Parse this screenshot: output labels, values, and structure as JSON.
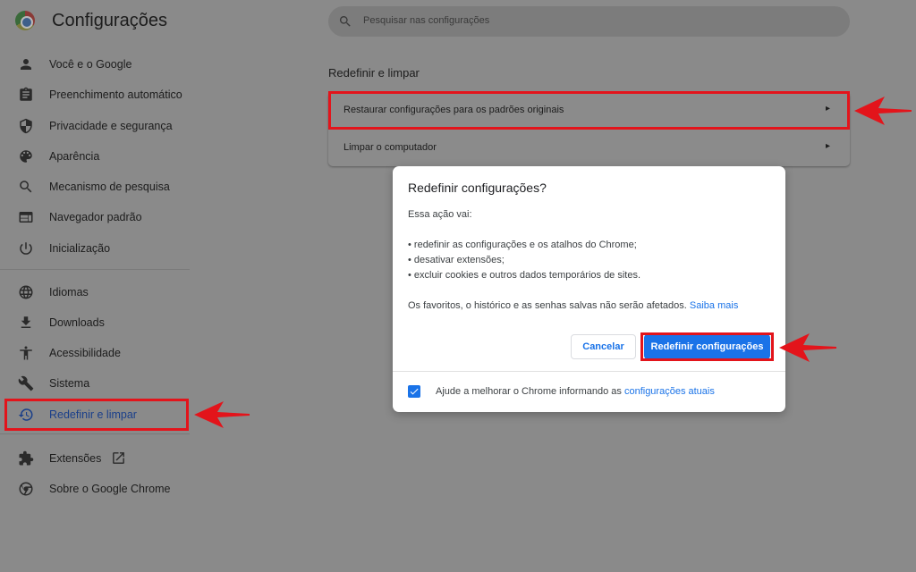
{
  "header": {
    "app_title": "Configurações",
    "search_placeholder": "Pesquisar nas configurações"
  },
  "sidebar": {
    "items": [
      {
        "label": "Você e o Google",
        "icon": "person-icon"
      },
      {
        "label": "Preenchimento automático",
        "icon": "clipboard-icon"
      },
      {
        "label": "Privacidade e segurança",
        "icon": "shield-icon"
      },
      {
        "label": "Aparência",
        "icon": "palette-icon"
      },
      {
        "label": "Mecanismo de pesquisa",
        "icon": "search-icon"
      },
      {
        "label": "Navegador padrão",
        "icon": "browser-window-icon"
      },
      {
        "label": "Inicialização",
        "icon": "power-icon"
      },
      {
        "label": "Idiomas",
        "icon": "globe-icon"
      },
      {
        "label": "Downloads",
        "icon": "download-icon"
      },
      {
        "label": "Acessibilidade",
        "icon": "accessibility-icon"
      },
      {
        "label": "Sistema",
        "icon": "wrench-icon"
      },
      {
        "label": "Redefinir e limpar",
        "icon": "history-icon",
        "active": true
      },
      {
        "label": "Extensões",
        "icon": "puzzle-icon"
      },
      {
        "label": "Sobre o Google Chrome",
        "icon": "chrome-icon"
      }
    ]
  },
  "main": {
    "section_title": "Redefinir e limpar",
    "rows": [
      {
        "label": "Restaurar configurações para os padrões originais"
      },
      {
        "label": "Limpar o computador"
      }
    ]
  },
  "dialog": {
    "title": "Redefinir configurações?",
    "intro": "Essa ação vai:",
    "bullets": [
      "• redefinir as configurações e os atalhos do Chrome;",
      "• desativar extensões;",
      "• excluir cookies e outros dados temporários de sites."
    ],
    "note": "Os favoritos, o histórico e as senhas salvas não serão afetados.",
    "learn_more": "Saiba mais",
    "cancel_label": "Cancelar",
    "reset_label": "Redefinir configurações",
    "checkbox_checked": true,
    "checkbox_text": "Ajude a melhorar o Chrome informando as",
    "checkbox_link": "configurações atuais"
  },
  "colors": {
    "accent": "#1a73e8",
    "annotation": "#e3141b",
    "backdrop": "#8a8a8a"
  }
}
